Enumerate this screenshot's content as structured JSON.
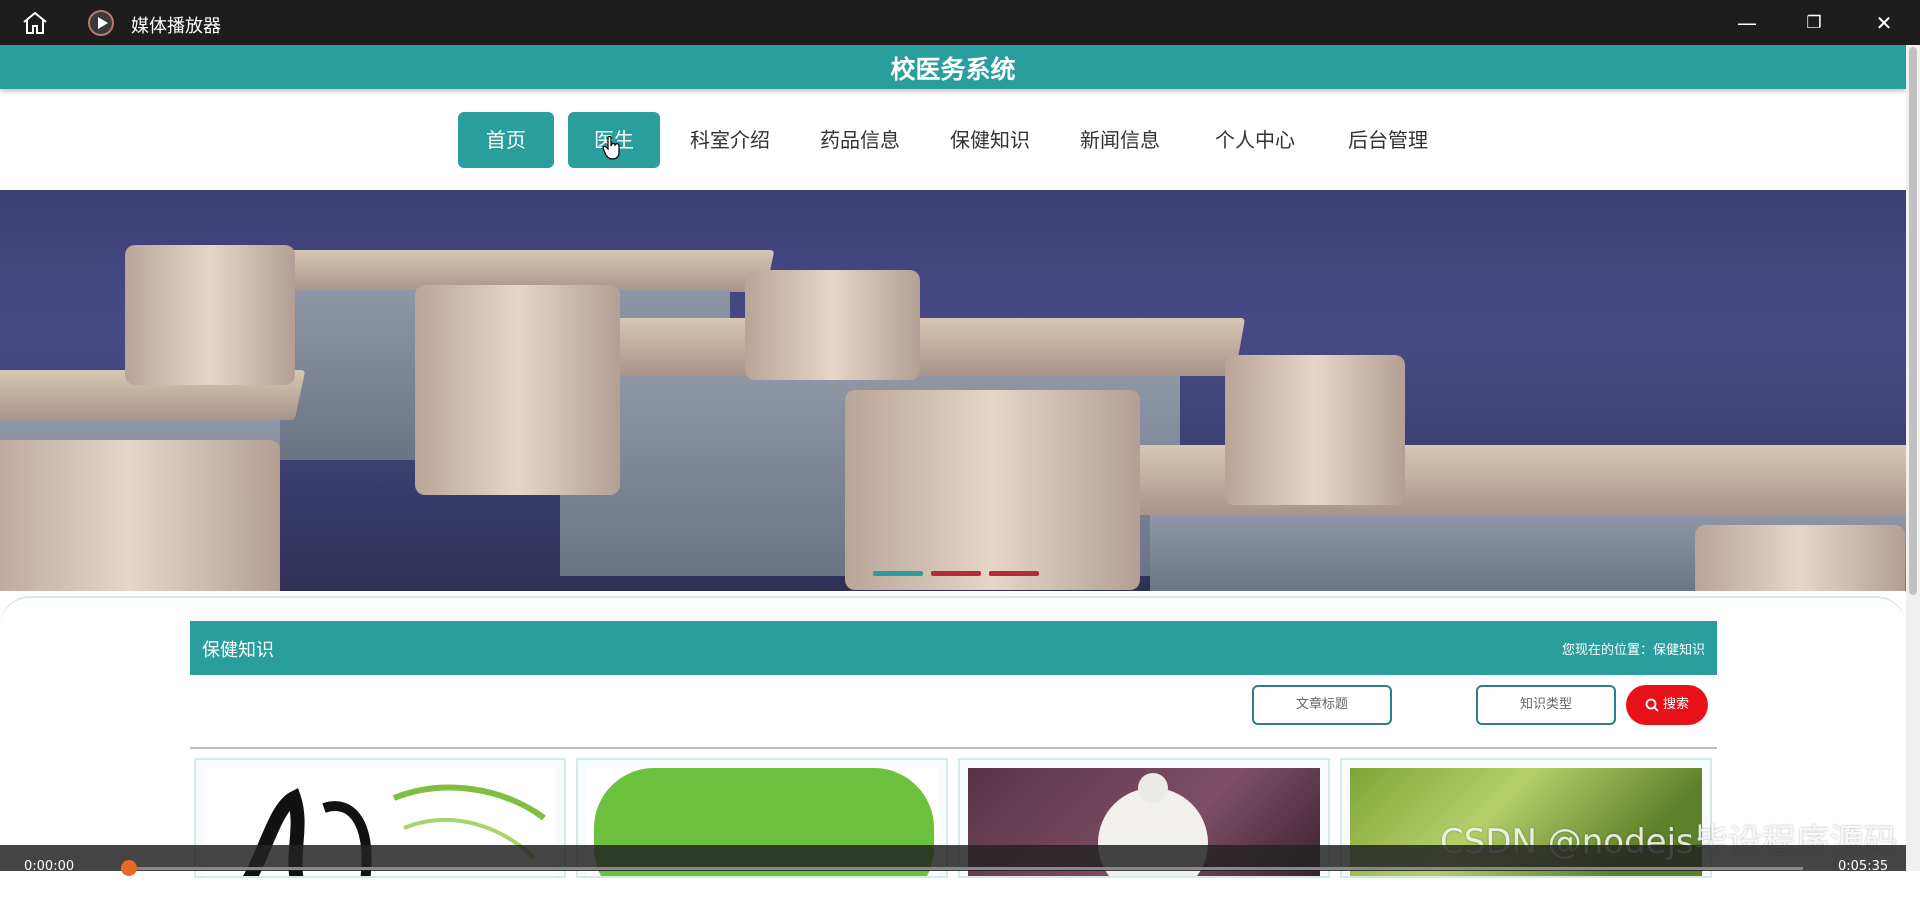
{
  "window": {
    "title": "媒体播放器",
    "controls": {
      "minimize": "—",
      "maximize": "❐",
      "close": "✕"
    }
  },
  "site": {
    "title": "校医务系统"
  },
  "nav": {
    "items": [
      {
        "label": "首页",
        "active": true
      },
      {
        "label": "医生",
        "active": true
      },
      {
        "label": "科室介绍",
        "active": false
      },
      {
        "label": "药品信息",
        "active": false
      },
      {
        "label": "保健知识",
        "active": false
      },
      {
        "label": "新闻信息",
        "active": false
      },
      {
        "label": "个人中心",
        "active": false
      },
      {
        "label": "后台管理",
        "active": false
      }
    ]
  },
  "section": {
    "title": "保健知识",
    "breadcrumb_prefix": "您现在的位置：",
    "breadcrumb_current": "保健知识"
  },
  "search": {
    "article_title_placeholder": "文章标题",
    "knowledge_type_placeholder": "知识类型",
    "button_label": "搜索"
  },
  "media": {
    "current_time": "0:00:00",
    "total_time": "0:05:35",
    "progress": 0.0
  },
  "watermark": "CSDN @nodejs毕设程序源码",
  "colors": {
    "accent": "#2a9d9d",
    "search": "#e8111a",
    "carousel_inactive": "#b52b3b"
  }
}
